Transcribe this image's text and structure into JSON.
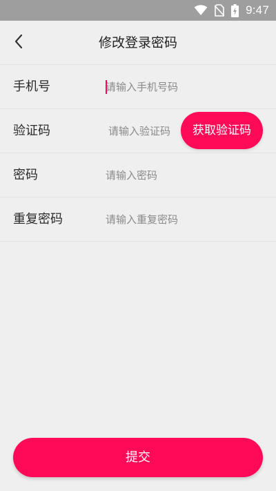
{
  "status_bar": {
    "time": "9:47",
    "icons": [
      "wifi-icon",
      "no-sim-icon",
      "battery-charging-icon"
    ]
  },
  "header": {
    "title": "修改登录密码",
    "back_icon": "chevron-left-icon"
  },
  "form": {
    "phone": {
      "label": "手机号",
      "placeholder": "请输入手机号码"
    },
    "code": {
      "label": "验证码",
      "placeholder": "请输入验证码",
      "button_label": "获取验证码"
    },
    "password": {
      "label": "密码",
      "placeholder": "请输入密码"
    },
    "confirm": {
      "label": "重复密码",
      "placeholder": "请输入重复密码"
    }
  },
  "submit_label": "提交",
  "colors": {
    "accent": "#ff0a58",
    "background": "#efefef",
    "status_bar": "#9e9e9e",
    "divider": "#e2e2e2"
  }
}
